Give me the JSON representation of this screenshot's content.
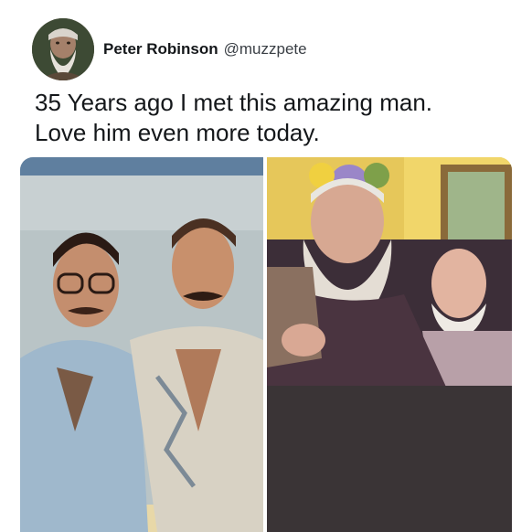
{
  "tweet": {
    "author": {
      "name": "Peter Robinson",
      "handle": "@muzzpete",
      "avatar_icon": "profile-photo"
    },
    "text_lines": [
      "35 Years ago I met this amazing man.",
      "Love him even more today."
    ],
    "media": [
      {
        "icon": "photo-then"
      },
      {
        "icon": "photo-now"
      }
    ]
  },
  "colors": {
    "text_primary": "#14171a",
    "text_secondary": "#3a3f45",
    "background": "#ffffff"
  }
}
